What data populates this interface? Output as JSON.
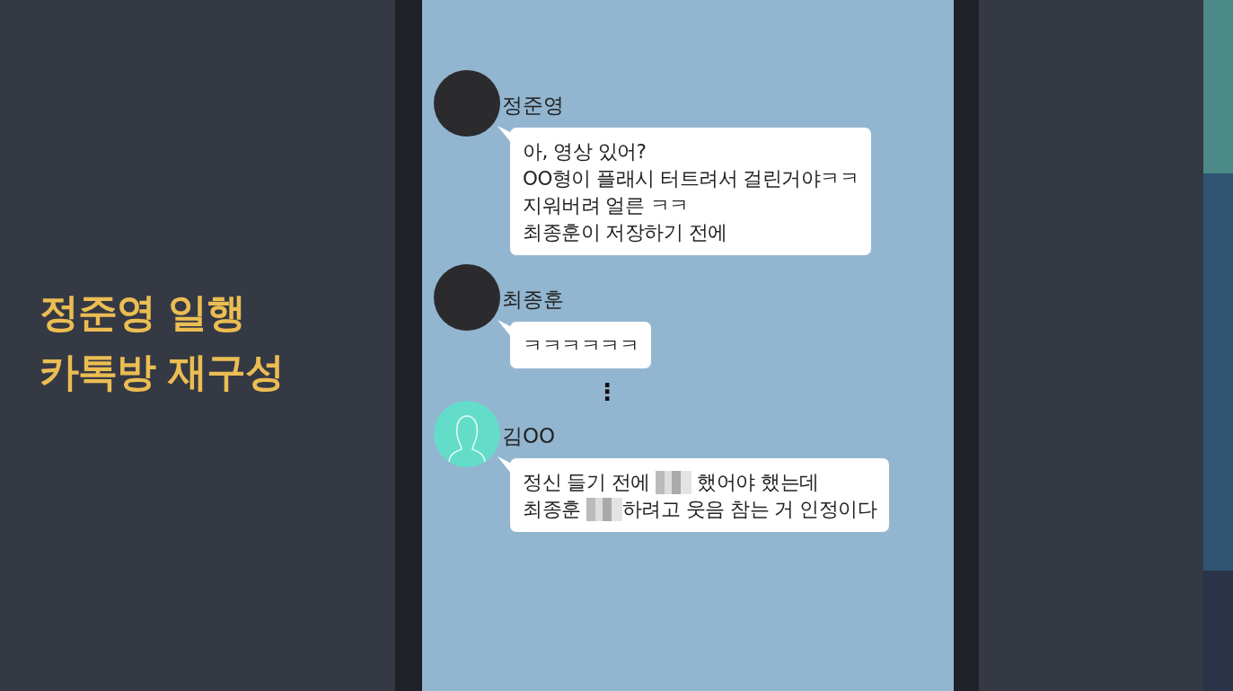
{
  "caption": {
    "lines": [
      "정준영 일행",
      "카톡방 재구성"
    ]
  },
  "chat": {
    "messages": [
      {
        "kind": "photo",
        "sender": "정준영",
        "lines": [
          [
            {
              "kind": "text",
              "text": "아, 영상 있어?"
            }
          ],
          [
            {
              "kind": "text",
              "text": "OO형이 플래시 터트려서 걸린거야ㅋㅋ"
            }
          ],
          [
            {
              "kind": "text",
              "text": "지워버려 얼른 ㅋㅋ"
            }
          ],
          [
            {
              "kind": "text",
              "text": "최종훈이 저장하기 전에"
            }
          ]
        ]
      },
      {
        "kind": "photo",
        "sender": "최종훈",
        "lines": [
          [
            {
              "kind": "text",
              "text": "ㅋㅋㅋㅋㅋㅋ"
            }
          ]
        ]
      },
      {
        "kind": "gap",
        "text": "⋮"
      },
      {
        "kind": "silhouette",
        "sender": "김OO",
        "lines": [
          [
            {
              "kind": "text",
              "text": "정신 들기 전에 "
            },
            {
              "kind": "blur"
            },
            {
              "kind": "text",
              "text": " 했어야 했는데"
            }
          ],
          [
            {
              "kind": "text",
              "text": "최종훈 "
            },
            {
              "kind": "blur"
            },
            {
              "kind": "text",
              "text": "하려고 웃음 참는 거 인정이다"
            }
          ]
        ]
      }
    ]
  }
}
